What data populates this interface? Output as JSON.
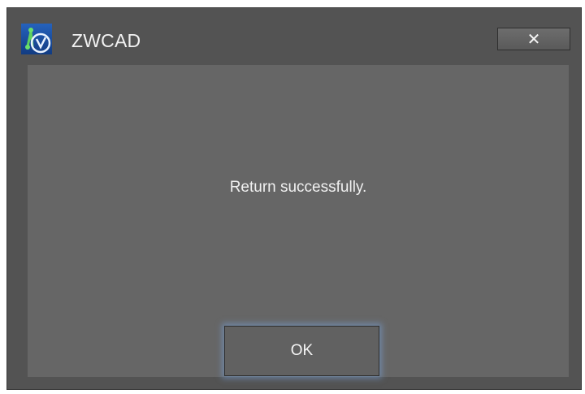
{
  "window": {
    "title": "ZWCAD",
    "close_icon": "close-icon",
    "app_icon": "zwcad-logo-icon"
  },
  "dialog": {
    "message": "Return successfully.",
    "ok_label": "OK"
  },
  "colors": {
    "frame": "#535353",
    "content": "#666666",
    "text": "#f0f0f0",
    "focus_glow": "#78a0d7",
    "icon_bg": "#1a4fa0"
  }
}
